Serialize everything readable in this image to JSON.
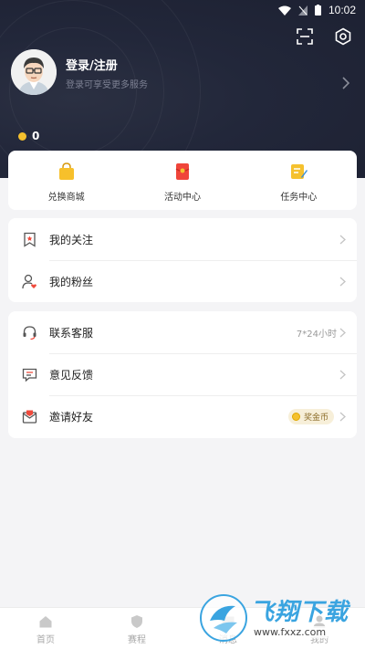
{
  "status_bar": {
    "time": "10:02"
  },
  "profile": {
    "title": "登录/注册",
    "subtitle": "登录可享受更多服务",
    "coin_value": "0"
  },
  "quick_menu": [
    {
      "label": "兑换商城",
      "icon": "shopping-bag-icon",
      "color": "#f7c02b"
    },
    {
      "label": "活动中心",
      "icon": "red-envelope-icon",
      "color": "#f0453a"
    },
    {
      "label": "任务中心",
      "icon": "task-note-icon",
      "color": "#f5c12e"
    }
  ],
  "menu_group_1": [
    {
      "label": "我的关注",
      "icon": "bookmark-icon"
    },
    {
      "label": "我的粉丝",
      "icon": "user-heart-icon"
    }
  ],
  "menu_group_2": [
    {
      "label": "联系客服",
      "icon": "headset-icon",
      "right_text": "7*24小时"
    },
    {
      "label": "意见反馈",
      "icon": "feedback-icon"
    },
    {
      "label": "邀请好友",
      "icon": "mail-invite-icon",
      "badge": "奖金币"
    }
  ],
  "tabbar": [
    {
      "label": "首页",
      "icon": "home-icon"
    },
    {
      "label": "赛程",
      "icon": "shield-icon"
    },
    {
      "label": "消息",
      "icon": "message-icon"
    },
    {
      "label": "我的",
      "icon": "profile-icon"
    }
  ],
  "watermark": {
    "title": "飞翔下载",
    "url": "www.fxxz.com"
  },
  "colors": {
    "header_bg": "#22273a",
    "accent_gold": "#f5c12e",
    "page_bg": "#f4f4f6"
  }
}
